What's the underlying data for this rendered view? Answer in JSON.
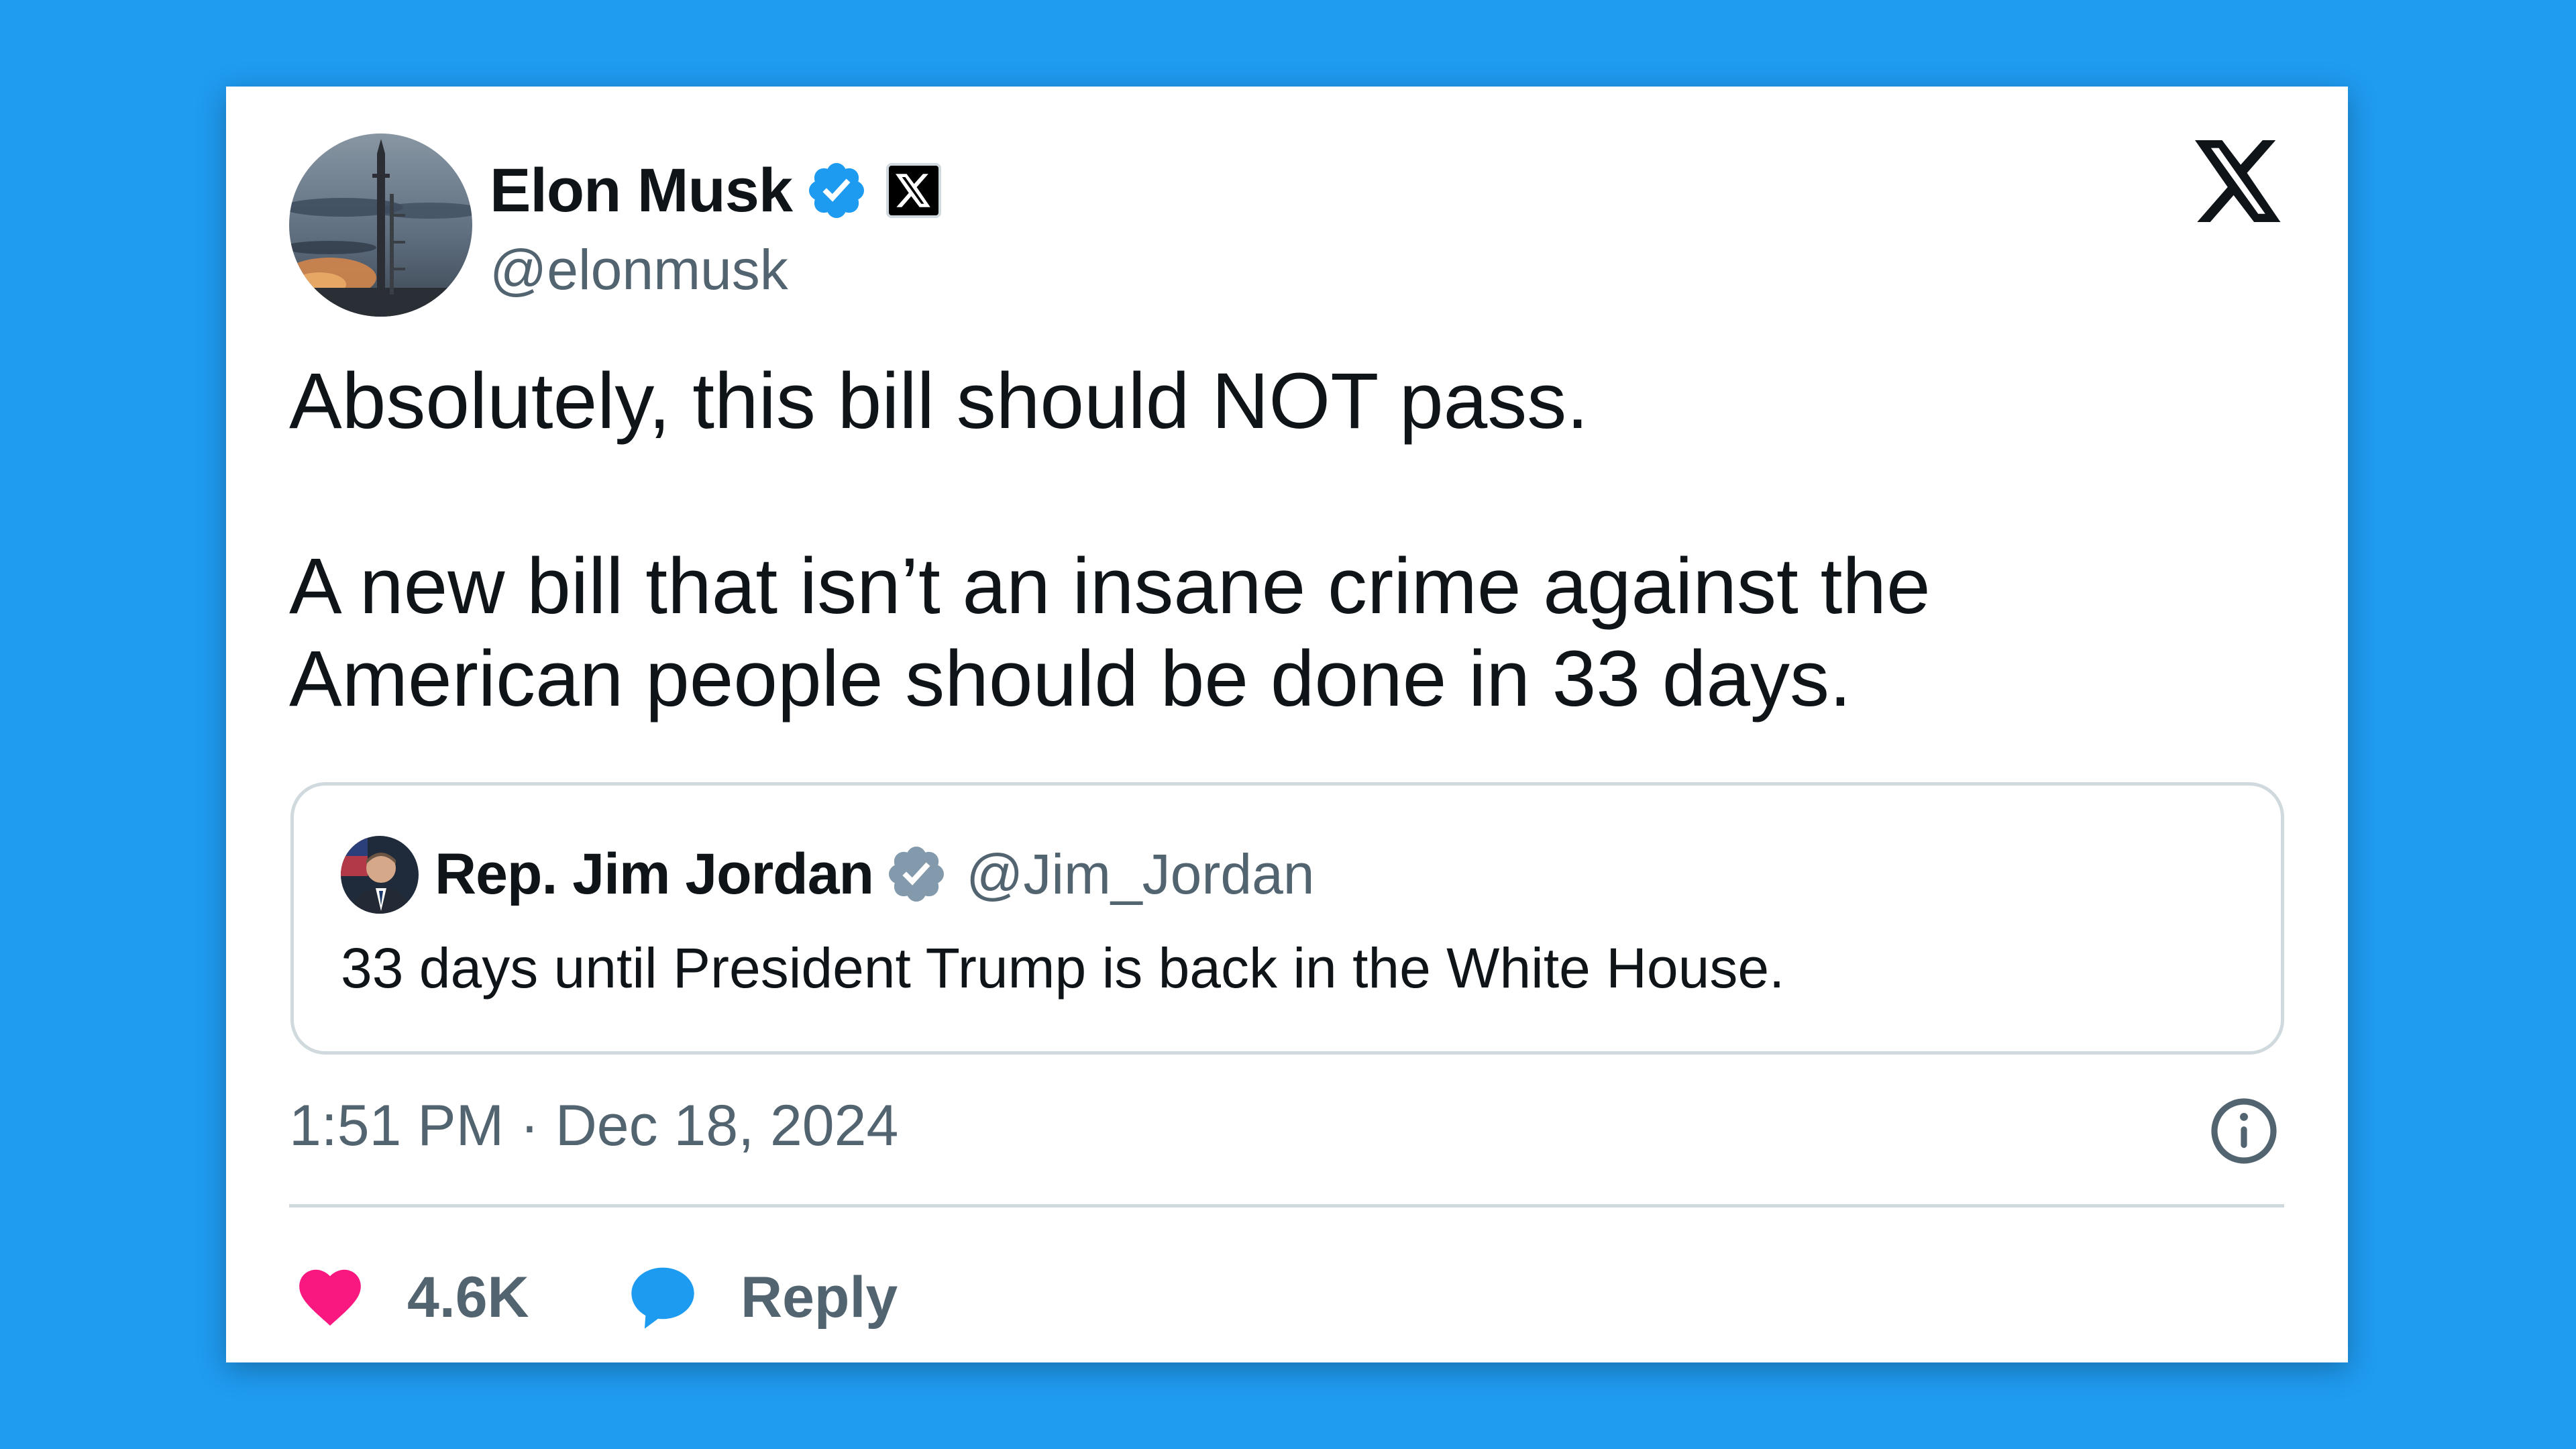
{
  "author": {
    "name": "Elon Musk",
    "handle": "@elonmusk",
    "verified_icon": "verified-badge-icon",
    "affiliation_icon": "x-affiliation-icon"
  },
  "platform_logo": "x-logo-icon",
  "tweet": {
    "text": "Absolutely, this bill should NOT pass.\n\nA new bill that isn’t an insane crime against the\nAmerican people should be done in 33 days."
  },
  "quoted_tweet": {
    "name": "Rep. Jim Jordan",
    "handle": "@Jim_Jordan",
    "verified_icon": "government-verified-badge-icon",
    "text": "33 days until President Trump is back in the White House."
  },
  "timestamp": "1:51 PM · Dec 18, 2024",
  "actions": {
    "like_count": "4.6K",
    "reply_label": "Reply"
  },
  "colors": {
    "background": "#1f9bf0",
    "card": "#ffffff",
    "text_primary": "#0f1419",
    "text_secondary": "#536471",
    "verified_blue": "#1d9bf0",
    "government_gray": "#829aab",
    "like_pink": "#f91880",
    "reply_blue": "#1d9bf0",
    "border": "#cfd9de"
  }
}
